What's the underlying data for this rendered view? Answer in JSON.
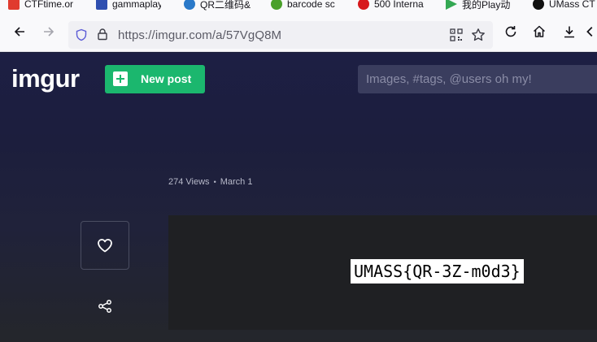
{
  "bookmarks": [
    {
      "label": "CTFtime.or",
      "icon": "ctftime-flag-icon",
      "color": "#e03b2f"
    },
    {
      "label": "gammaplay",
      "icon": "gamma-icon",
      "color": "#2f4fb0"
    },
    {
      "label": "QR二维码&",
      "icon": "qr-s-icon",
      "color": "#2a79c9"
    },
    {
      "label": "barcode sc",
      "icon": "barcode-icon",
      "color": "#4aa02a"
    },
    {
      "label": "500 Interna",
      "icon": "pinterest-icon",
      "color": "#d7191c"
    },
    {
      "label": "我的Play动",
      "icon": "play-store-icon",
      "color": "#34a853"
    },
    {
      "label": "UMass CT",
      "icon": "github-icon",
      "color": "#111111"
    }
  ],
  "toolbar": {
    "url": "https://imgur.com/a/57VgQ8M"
  },
  "site": {
    "logo": "imgur",
    "new_post_label": "New post",
    "search_placeholder": "Images, #tags, @users oh my!"
  },
  "post": {
    "views": "274 Views",
    "separator": "•",
    "date": "March 1",
    "image_text": "UMASS{QR-3Z-m0d3}"
  }
}
